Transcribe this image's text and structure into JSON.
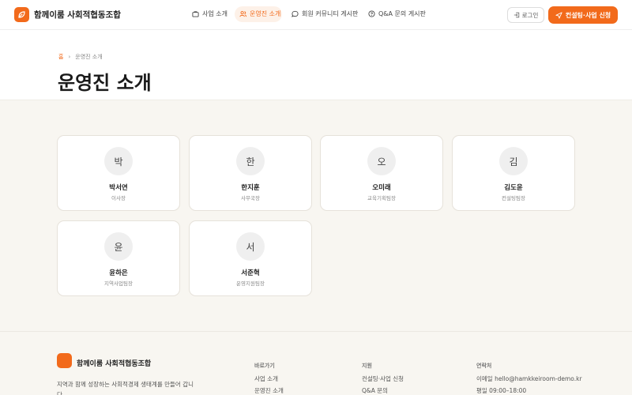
{
  "header": {
    "brand": "함께이룸 사회적협동조합",
    "nav": [
      {
        "label": "사업 소개",
        "icon": "briefcase-icon",
        "active": false
      },
      {
        "label": "운영진 소개",
        "icon": "users-icon",
        "active": true
      },
      {
        "label": "회원 커뮤니티 게시판",
        "icon": "chat-bubble-icon",
        "active": false
      },
      {
        "label": "Q&A 문의 게시판",
        "icon": "question-circle-icon",
        "active": false
      }
    ],
    "login_label": "로그인",
    "cta_label": "컨설팅·사업 신청"
  },
  "hero": {
    "breadcrumb_home": "홈",
    "breadcrumb_current": "운영진 소개",
    "title": "운영진 소개"
  },
  "members": [
    {
      "initial": "박",
      "name": "박서연",
      "role": "이사장"
    },
    {
      "initial": "한",
      "name": "한지훈",
      "role": "사무국장"
    },
    {
      "initial": "오",
      "name": "오미래",
      "role": "교육기획팀장"
    },
    {
      "initial": "김",
      "name": "김도윤",
      "role": "컨설팅팀장"
    },
    {
      "initial": "윤",
      "name": "윤하은",
      "role": "지역사업팀장"
    },
    {
      "initial": "서",
      "name": "서준혁",
      "role": "운영지원팀장"
    }
  ],
  "footer": {
    "brand": "함께이룸 사회적협동조합",
    "description": "지역과 함께 성장하는 사회적경제 생태계를 만들어 갑니다.",
    "col1": {
      "title": "바로가기",
      "links": [
        "사업 소개",
        "운영진 소개"
      ]
    },
    "col2": {
      "title": "지원",
      "links": [
        "컨설팅·사업 신청",
        "Q&A 문의"
      ]
    },
    "col3": {
      "title": "연락처",
      "lines": [
        "이메일 hello@hamkkeiroom-demo.kr",
        "평일 09:00–18:00"
      ]
    }
  },
  "colors": {
    "accent": "#f26a1b",
    "background_muted": "#f8f6f1"
  }
}
